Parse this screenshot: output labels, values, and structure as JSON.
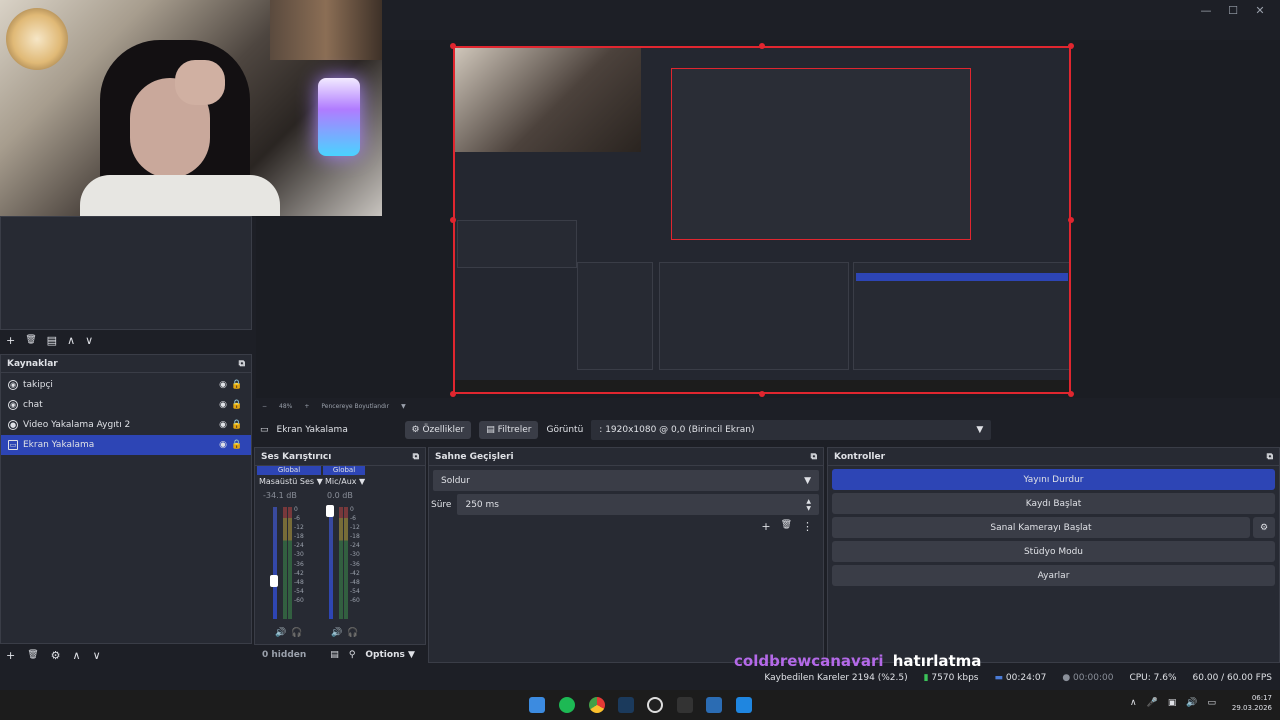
{
  "window": {
    "minimize": "—",
    "maximize": "☐",
    "close": "✕"
  },
  "scene_toolbar": {
    "add": "+",
    "remove": "🗑",
    "filter": "▤",
    "up": "∧",
    "down": "∨"
  },
  "sources": {
    "title": "Kaynaklar",
    "items": [
      {
        "label": "takipçi",
        "selected": false
      },
      {
        "label": "chat",
        "selected": false
      },
      {
        "label": "Video Yakalama Aygıtı 2",
        "selected": false
      },
      {
        "label": "Ekran Yakalama",
        "selected": true
      }
    ]
  },
  "preview": {
    "zoom": "48%",
    "fit_label": "Pencereye Boyutlandır"
  },
  "context": {
    "source_name": "Ekran Yakalama",
    "properties": "Özellikler",
    "filters": "Filtreler",
    "display_label": "Görüntü",
    "display_value": ": 1920x1080 @ 0,0 (Birincil Ekran)"
  },
  "mixer": {
    "title": "Ses Karıştırıcı",
    "channels": [
      {
        "badge": "Global",
        "name": "Masaüstü Ses",
        "db": "-34.1 dB",
        "level_pct": 45
      },
      {
        "badge": "Global",
        "name": "Mic/Aux",
        "db": "0.0 dB",
        "level_pct": 100
      }
    ],
    "scale": [
      "0",
      "-6",
      "-12",
      "-18",
      "-24",
      "-30",
      "-36",
      "-42",
      "-48",
      "-54",
      "-60"
    ],
    "hidden": "0 hidden",
    "options": "Options"
  },
  "transitions": {
    "title": "Sahne Geçişleri",
    "selected": "Soldur",
    "duration_label": "Süre",
    "duration_value": "250 ms"
  },
  "controls": {
    "title": "Kontroller",
    "stop_stream": "Yayını Durdur",
    "start_record": "Kaydı Başlat",
    "start_vcam": "Sanal Kamerayı Başlat",
    "studio_mode": "Stüdyo Modu",
    "settings": "Ayarlar"
  },
  "overlay": {
    "name": "coldbrewcanavari",
    "text": "hatırlatma",
    "name_color": "#b469e8"
  },
  "status": {
    "dropped": "Kaybedilen Kareler 2194 (%2.5)",
    "bitrate": "7570 kbps",
    "stream_time": "00:24:07",
    "record_time": "00:00:00",
    "cpu": "CPU: 7.6%",
    "fps": "60.00 / 60.00 FPS"
  },
  "taskbar": {
    "time": "06:17",
    "date": "29.03.2026"
  },
  "colors": {
    "accent": "#2d45b5",
    "selection_border": "#e0262f",
    "panel": "#272a33",
    "bg": "#1d1f26"
  }
}
